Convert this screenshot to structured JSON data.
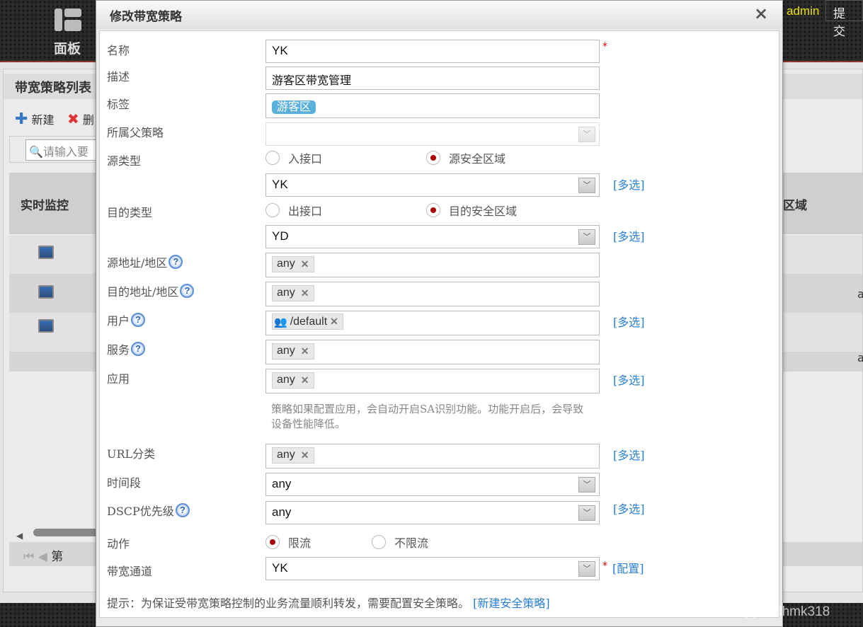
{
  "topbar": {
    "nav_label": "面板",
    "user": "admin",
    "submit": "提交"
  },
  "background": {
    "panel_title": "带宽策略列表",
    "toolbar": {
      "new": "新建",
      "delete": "删"
    },
    "search_placeholder": "请输入要",
    "table_header": {
      "monitor": "实时监控",
      "zone": "区域"
    },
    "row_text": [
      "a",
      "a"
    ],
    "pager": {
      "page": "第"
    }
  },
  "dialog": {
    "title": "修改带宽策略",
    "labels": {
      "name": "名称",
      "desc": "描述",
      "tag": "标签",
      "parent": "所属父策略",
      "src_type": "源类型",
      "dst_type": "目的类型",
      "src_addr": "源地址/地区",
      "dst_addr": "目的地址/地区",
      "user": "用户",
      "service": "服务",
      "app": "应用",
      "url": "URL分类",
      "time": "时间段",
      "dscp": "DSCP优先级",
      "action": "动作",
      "channel": "带宽通道"
    },
    "values": {
      "name": "YK",
      "desc": "游客区带宽管理",
      "tag": "游客区",
      "parent": "",
      "src_zone": "YK",
      "dst_zone": "YD",
      "src_addr": "any",
      "dst_addr": "any",
      "user": "/default",
      "service": "any",
      "app": "any",
      "url": "any",
      "time": "any",
      "dscp": "any",
      "channel": "YK"
    },
    "radios": {
      "src_iface": "入接口",
      "src_zone": "源安全区域",
      "dst_iface": "出接口",
      "dst_zone": "目的安全区域",
      "limit": "限流",
      "nolimit": "不限流"
    },
    "multi": "[多选]",
    "config": "[配置]",
    "required": "*",
    "app_note": "策略如果配置应用，会自动开启SA识别功能。功能开启后，会导致设备性能降低。",
    "hint": "提示：为保证受带宽策略控制的业务流量顺利转发，需要配置安全策略。",
    "hint_link": "[新建安全策略]",
    "close": "×"
  },
  "watermark": "CSDN @pdxdhmk318"
}
